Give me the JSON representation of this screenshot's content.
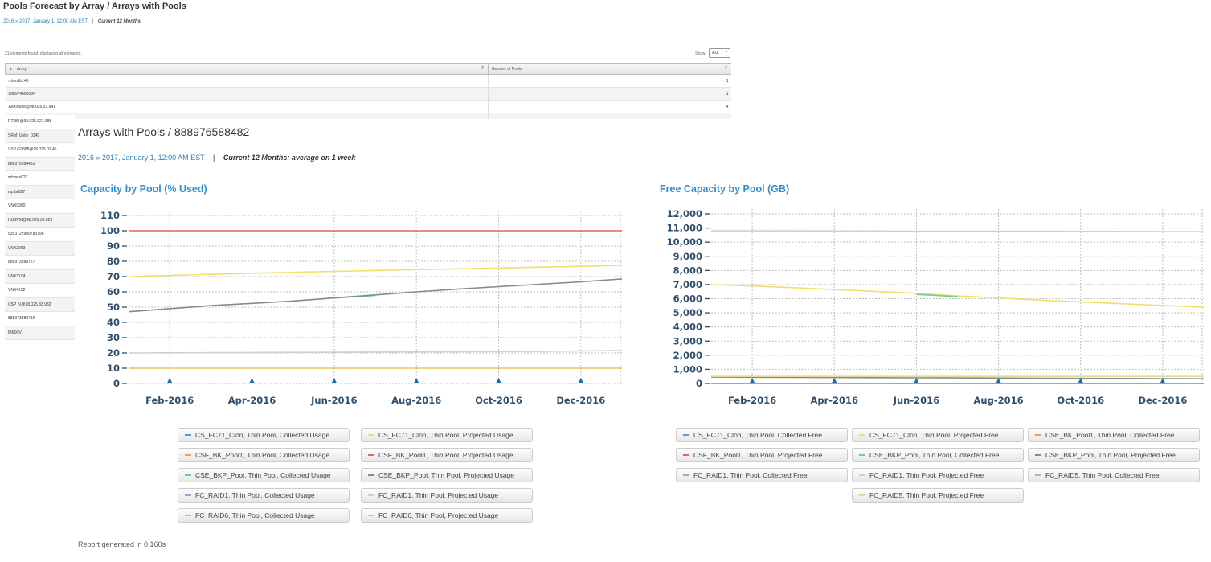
{
  "header": {
    "title": "Pools Forecast by Array / Arrays with Pools",
    "date_range": "2016 » 2017, January 1, 12:00 AM EST",
    "separator": "|",
    "period": "Current 12 Months"
  },
  "table": {
    "found_text": "21 elements found, displaying all elements.",
    "show_label": "Show",
    "show_value": "ALL",
    "columns": [
      "Array",
      "Number of Pools"
    ],
    "rows": [
      {
        "array": "mhmdb145",
        "pools": "1"
      },
      {
        "array": "888974688084",
        "pools": "1"
      },
      {
        "array": "AM60988@98.025.33.941",
        "pools": "4"
      }
    ],
    "left_list": [
      "P7388@98.025.921.985",
      "SRM_Unity_0349",
      "VSP G9888@98.025.02.45",
      "888976588482",
      "mhmcx022",
      "mptbr027",
      "VNX9360",
      "HUSVM@98.025.33.023",
      "5263725989783798",
      "VNX2063",
      "888973588727",
      "VNX3104",
      "VNX4102",
      "USP_V@98.025.33.932",
      "888973588710",
      "IBMXIV"
    ]
  },
  "panel": {
    "title": "Arrays with Pools / 888976588482",
    "date_range": "2016 » 2017, January 1, 12:00 AM EST",
    "separator": "|",
    "period": "Current 12 Months: average on 1 week",
    "footer": "Report generated in 0.160s"
  },
  "colors": {
    "accent_title": "#2e8fd6",
    "axis_text": "#2f4f6f",
    "tick_marker": "#1f6fa0"
  },
  "chart_data": [
    {
      "type": "line",
      "title": "Capacity by Pool (% Used)",
      "xlabel": "",
      "ylabel": "",
      "ylim": [
        0,
        110
      ],
      "yticks": [
        "0",
        "10",
        "20",
        "30",
        "40",
        "50",
        "60",
        "70",
        "80",
        "90",
        "100",
        "110"
      ],
      "x_ticks": [
        "Feb-2016",
        "Apr-2016",
        "Jun-2016",
        "Aug-2016",
        "Oct-2016",
        "Dec-2016"
      ],
      "grid": true,
      "legend_position": "bottom",
      "x": [
        "Jan-2016",
        "Feb-2016",
        "Mar-2016",
        "Apr-2016",
        "May-2016",
        "Jun-2016",
        "Jul-2016",
        "Aug-2016",
        "Sep-2016",
        "Oct-2016",
        "Nov-2016",
        "Dec-2016",
        "Jan-2017"
      ],
      "series": [
        {
          "name": "CS_FC71_Clon, Thin Pool, Collected Usage",
          "color": "#5b9bd5",
          "values": [
            null,
            null,
            null,
            null,
            null,
            null,
            null,
            null,
            null,
            null,
            null,
            null,
            null
          ]
        },
        {
          "name": "CS_FC71_Clon, Thin Pool, Projected Usage",
          "color": "#f2de6a",
          "values": [
            70,
            70.8,
            71.5,
            72.2,
            72.8,
            73.4,
            74,
            74.6,
            75.1,
            75.6,
            76.2,
            76.7,
            77.4
          ]
        },
        {
          "name": "CSF_BK_Pool1, Thin Pool, Collected Usage",
          "color": "#f0a050",
          "values": [
            null,
            null,
            null,
            null,
            null,
            null,
            null,
            null,
            null,
            null,
            null,
            null,
            null
          ]
        },
        {
          "name": "CSF_BK_Pool1, Thin Pool, Projected Usage",
          "color": "#e8635a",
          "values": [
            100,
            100,
            100,
            100,
            100,
            100,
            100,
            100,
            100,
            100,
            100,
            100,
            100
          ]
        },
        {
          "name": "CSE_BKP_Pool, Thin Pool, Collected Usage",
          "color": "#6ccf8f",
          "values": [
            null,
            null,
            null,
            null,
            null,
            56,
            57.6,
            null,
            null,
            null,
            null,
            null,
            null
          ]
        },
        {
          "name": "CSE_BKP_Pool, Thin Pool, Projected Usage",
          "color": "#7f8c93",
          "values": [
            47,
            49,
            51,
            52.5,
            54,
            56,
            58,
            60,
            61.8,
            63.4,
            65,
            66.6,
            68.5
          ]
        },
        {
          "name": "FC_RAID1, Thin Pool, Collected Usage",
          "color": "#c095d0",
          "values": [
            null,
            null,
            null,
            null,
            null,
            null,
            null,
            null,
            null,
            null,
            null,
            null,
            null
          ]
        },
        {
          "name": "FC_RAID1, Thin Pool, Projected Usage",
          "color": "#cfcfcf",
          "values": [
            20,
            20.1,
            20.2,
            20.3,
            20.4,
            20.5,
            20.6,
            20.7,
            20.8,
            20.9,
            21,
            21.3,
            21.6
          ]
        },
        {
          "name": "FC_RAID6, Thin Pool, Collected Usage",
          "color": "#8ec0e8",
          "values": [
            null,
            null,
            null,
            null,
            null,
            null,
            null,
            null,
            null,
            null,
            null,
            null,
            null
          ]
        },
        {
          "name": "FC_RAID6, Thin Pool, Projected Usage",
          "color": "#e8c25a",
          "values": [
            10,
            10,
            10,
            10,
            10,
            10,
            10,
            10,
            10,
            10,
            10,
            10,
            10
          ]
        }
      ]
    },
    {
      "type": "line",
      "title": "Free Capacity by Pool (GB)",
      "xlabel": "",
      "ylabel": "",
      "ylim": [
        0,
        12000
      ],
      "yticks": [
        "0",
        "1,000",
        "2,000",
        "3,000",
        "4,000",
        "5,000",
        "6,000",
        "7,000",
        "8,000",
        "9,000",
        "10,000",
        "11,000",
        "12,000"
      ],
      "x_ticks": [
        "Feb-2016",
        "Apr-2016",
        "Jun-2016",
        "Aug-2016",
        "Oct-2016",
        "Dec-2016"
      ],
      "grid": true,
      "legend_position": "bottom",
      "x": [
        "Jan-2016",
        "Feb-2016",
        "Mar-2016",
        "Apr-2016",
        "May-2016",
        "Jun-2016",
        "Jul-2016",
        "Aug-2016",
        "Sep-2016",
        "Oct-2016",
        "Nov-2016",
        "Dec-2016",
        "Jan-2017"
      ],
      "series": [
        {
          "name": "CS_FC71_Clon, Thin Pool, Collected Free",
          "color": "#5b9bd5",
          "values": [
            null,
            null,
            null,
            null,
            null,
            null,
            null,
            null,
            null,
            null,
            null,
            null,
            null
          ]
        },
        {
          "name": "CS_FC71_Clon, Thin Pool, Projected Free",
          "color": "#f2de6a",
          "values": [
            7000,
            6900,
            6780,
            6650,
            6520,
            6380,
            6200,
            6050,
            5900,
            5780,
            5650,
            5520,
            5400
          ]
        },
        {
          "name": "CSE_BK_Pool1, Thin Pool, Collected Free",
          "color": "#f0a050",
          "values": [
            null,
            null,
            null,
            null,
            null,
            null,
            null,
            null,
            null,
            null,
            null,
            null,
            null
          ]
        },
        {
          "name": "CSF_BK_Pool1, Thin Pool, Projected Free",
          "color": "#e8635a",
          "values": [
            0,
            0,
            0,
            0,
            0,
            0,
            0,
            0,
            0,
            0,
            0,
            0,
            0
          ]
        },
        {
          "name": "CSE_BKP_Pool, Thin Pool, Collected Free",
          "color": "#6ccf8f",
          "values": [
            null,
            null,
            null,
            null,
            null,
            6300,
            6150,
            null,
            null,
            null,
            null,
            null,
            null
          ]
        },
        {
          "name": "CSE_BKP_Pool, Thin Pool, Projected Free",
          "color": "#7f8c93",
          "values": [
            450,
            440,
            430,
            420,
            410,
            400,
            390,
            380,
            370,
            360,
            350,
            340,
            330
          ]
        },
        {
          "name": "FC_RAID1, Thin Pool, Collected Free",
          "color": "#c095d0",
          "values": [
            null,
            null,
            null,
            null,
            null,
            null,
            null,
            null,
            null,
            null,
            null,
            null,
            null
          ]
        },
        {
          "name": "FC_RAID1, Thin Pool, Projected Free",
          "color": "#cfcfcf",
          "values": [
            10800,
            10800,
            10800,
            10790,
            10790,
            10780,
            10780,
            10770,
            10770,
            10760,
            10760,
            10750,
            10750
          ]
        },
        {
          "name": "FC_RAID5, Thin Pool, Collected Free",
          "color": "#8ec0e8",
          "values": [
            null,
            null,
            null,
            null,
            null,
            null,
            null,
            null,
            null,
            null,
            null,
            null,
            null
          ]
        },
        {
          "name": "FC_RAID5, Thin Pool, Projected Free",
          "color": "#e8d890",
          "values": [
            500,
            500,
            500,
            500,
            500,
            500,
            500,
            500,
            500,
            500,
            500,
            500,
            500
          ]
        }
      ]
    }
  ]
}
